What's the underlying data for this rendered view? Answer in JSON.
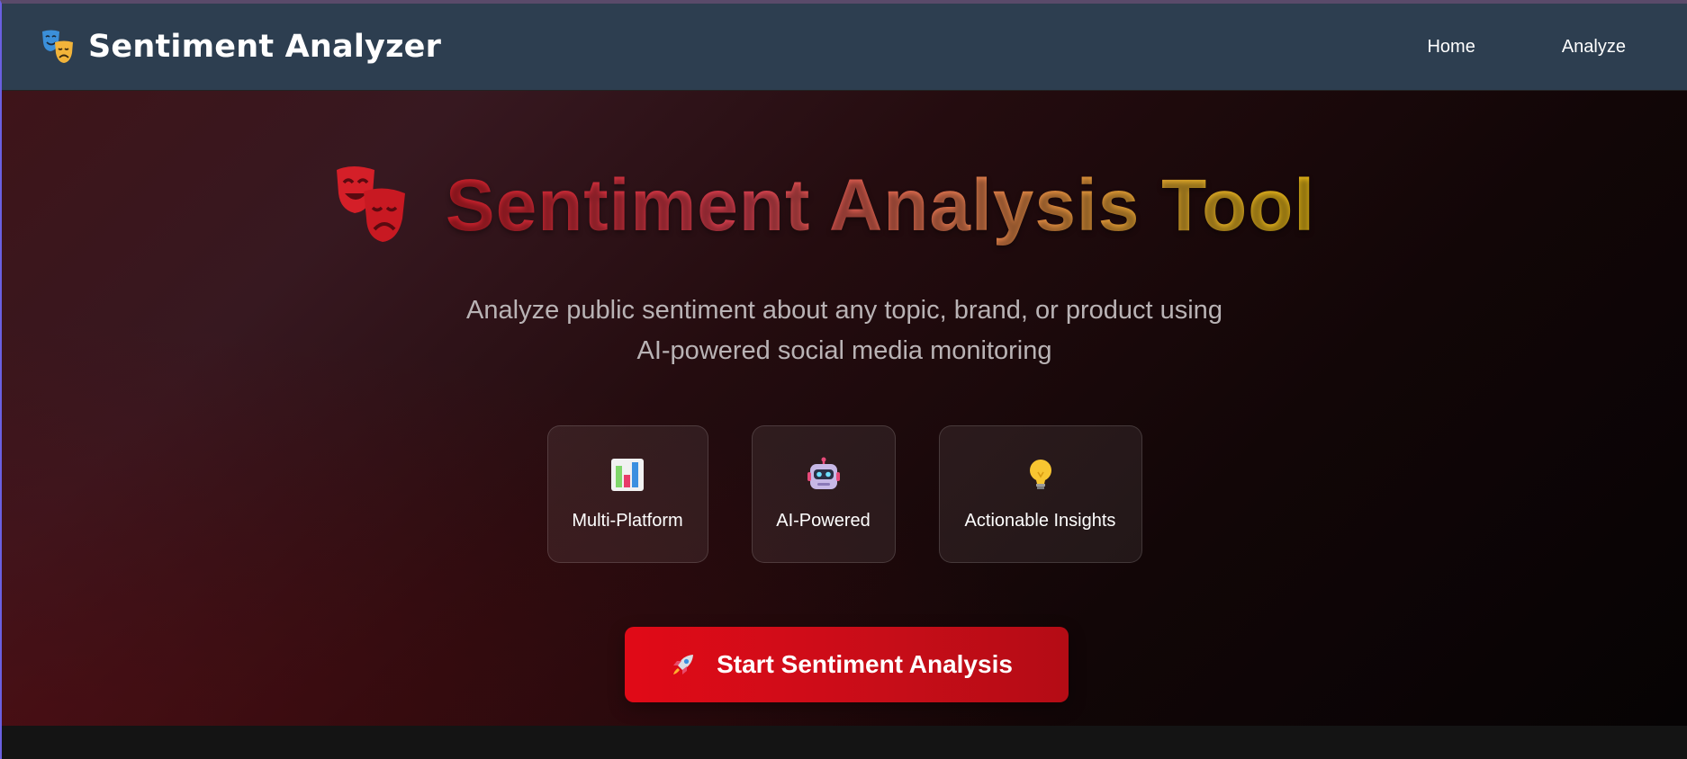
{
  "navbar": {
    "brand_title": "Sentiment Analyzer",
    "brand_icon": "theater-masks-icon",
    "links": [
      {
        "label": "Home"
      },
      {
        "label": "Analyze"
      }
    ]
  },
  "hero": {
    "title_icon": "theater-masks-icon",
    "title": "Sentiment Analysis Tool",
    "subtitle_line1": "Analyze public sentiment about any topic, brand, or product using",
    "subtitle_line2": "AI-powered social media monitoring",
    "features": [
      {
        "icon": "bar-chart-icon",
        "label": "Multi-Platform"
      },
      {
        "icon": "robot-icon",
        "label": "AI-Powered"
      },
      {
        "icon": "light-bulb-icon",
        "label": "Actionable Insights"
      }
    ],
    "cta": {
      "icon": "rocket-icon",
      "label": "Start Sentiment Analysis"
    }
  },
  "colors": {
    "navbar_bg": "#2d3e50",
    "cta_red": "#e10a17",
    "title_gradient_start": "#cc1f2a",
    "title_gradient_end": "#e2b415"
  }
}
